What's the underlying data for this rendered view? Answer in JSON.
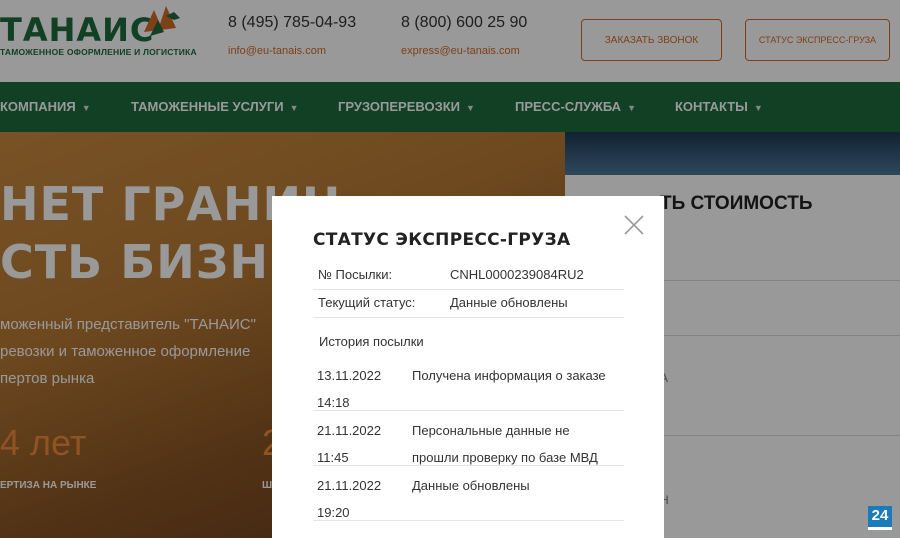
{
  "header": {
    "logo_text": "ТАНАИС",
    "logo_subtitle": "ТАМОЖЕННОЕ ОФОРМЛЕНИЕ И ЛОГИСТИКА",
    "phone_1": "8 (495) 785-04-93",
    "email_1": "info@eu-tanais.com",
    "phone_2": "8 (800) 600 25 90",
    "email_2": "express@eu-tanais.com",
    "callback_button": "ЗАКАЗАТЬ ЗВОНОК",
    "status_button": "СТАТУС ЭКСПРЕСС-ГРУЗА"
  },
  "nav": {
    "items": [
      {
        "label": "КОМПАНИЯ"
      },
      {
        "label": "ТАМОЖЕННЫЕ УСЛУГИ"
      },
      {
        "label": "ГРУЗОПЕРЕВОЗКИ"
      },
      {
        "label": "ПРЕСС-СЛУЖБА"
      },
      {
        "label": "КОНТАКТЫ"
      }
    ]
  },
  "hero": {
    "heading_1": "НЕТ ГРАНИЦ",
    "heading_2": "СТЬ БИЗНЕС",
    "text_1": "моженный представитель \"ТАНАИС\"",
    "text_2": "ревозки и таможенное оформление",
    "text_3": "пертов рынка",
    "stat_1_value": "4 лет",
    "stat_1_label": "ЕРТИЗА НА РЫНКЕ",
    "stat_2_value": "2",
    "stat_2_label": "Ш"
  },
  "form": {
    "title": "ТЬ СТОИМОСТЬ",
    "label_1": "А",
    "label_2": "Н"
  },
  "modal": {
    "title": "СТАТУС ЭКСПРЕСС-ГРУЗА",
    "parcel_label": "№ Посылки:",
    "parcel_value": "CNHL0000239084RU2",
    "status_label": "Текущий статус:",
    "status_value": "Данные обновлены",
    "history_title": "История посылки",
    "history": [
      {
        "date": "13.11.2022 14:18",
        "description": "Получена информация о заказе"
      },
      {
        "date": "21.11.2022 11:45",
        "description": "Персональные данные не прошли проверку по базе МВД"
      },
      {
        "date": "21.11.2022 19:20",
        "description": "Данные обновлены"
      }
    ]
  },
  "widget": {
    "badge_text": "24"
  },
  "colors": {
    "brand_green": "#1d6b3f",
    "accent_orange": "#d26b27"
  }
}
